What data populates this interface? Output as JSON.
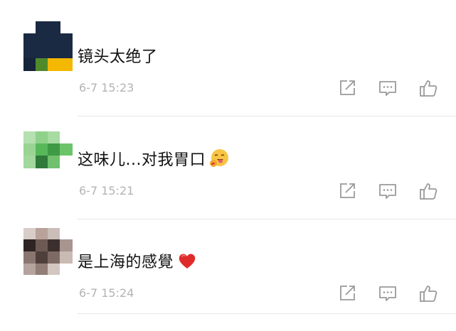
{
  "comments": [
    {
      "text": "镜头太绝了",
      "time": "6-7 15:23",
      "emoji": "",
      "avatar_colors": [
        "#1b2a43",
        "#4f8a2a",
        "#f5b800"
      ]
    },
    {
      "text": "这味儿...对我胃口",
      "time": "6-7 15:21",
      "emoji": "tongue-hug-emoji",
      "avatar_colors": [
        "#8fd18a",
        "#57b85a",
        "#2f7a3a"
      ]
    },
    {
      "text": "是上海的感覺",
      "time": "6-7 15:24",
      "emoji": "red-heart-emoji",
      "avatar_colors": [
        "#b8a29a",
        "#6d5a55",
        "#2e2524"
      ]
    }
  ],
  "icons": {
    "share": "share-icon",
    "reply": "comment-icon",
    "like": "thumbs-up-icon"
  },
  "colors": {
    "text": "#111111",
    "timestamp": "#b3b3b3",
    "icon": "#9a9a9a",
    "divider": "#e6e6e6",
    "heart": "#e02b2b"
  }
}
